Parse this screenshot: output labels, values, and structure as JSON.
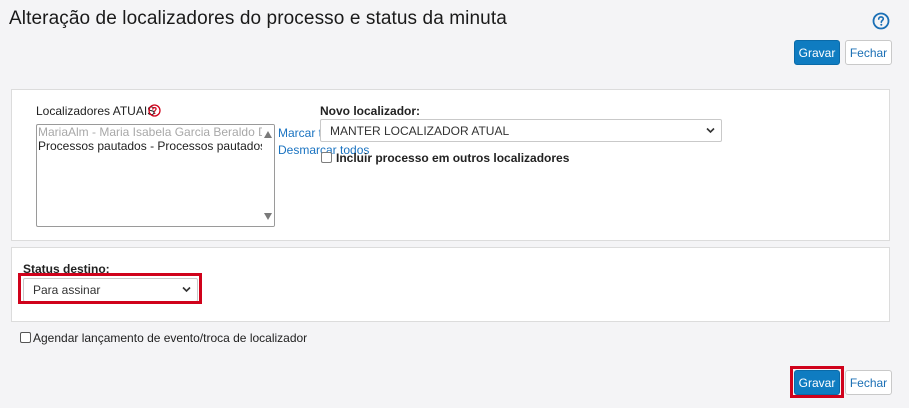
{
  "header": {
    "title": "Alteração de localizadores do processo e status da minuta",
    "help_icon": "help-circle-icon"
  },
  "top_actions": {
    "save_label": "Gravar",
    "close_label": "Fechar"
  },
  "locators_panel": {
    "current_label": "Localizadores ATUAIS",
    "current_items": [
      {
        "text": "MariaAlm - Maria Isabela Garcia Beraldo De Almeida",
        "disabled": true
      },
      {
        "text": "Processos pautados - Processos pautados Aguardando Julgamento",
        "disabled": false
      }
    ],
    "mark_all_label": "Marcar todos",
    "unmark_all_label": "Desmarcar todos",
    "new_locator_label": "Novo localizador:",
    "new_locator_value": "MANTER LOCALIZADOR ATUAL",
    "include_other_label": "Incluir processo em outros localizadores"
  },
  "status_panel": {
    "label": "Status destino:",
    "value": "Para assinar"
  },
  "schedule_label": "Agendar lançamento de evento/troca de localizador",
  "bottom_actions": {
    "save_label": "Gravar",
    "close_label": "Fechar"
  },
  "colors": {
    "primary": "#0f7cc1",
    "highlight": "#d0021b",
    "link": "#1a73c1",
    "help": "#1a6fb5"
  }
}
